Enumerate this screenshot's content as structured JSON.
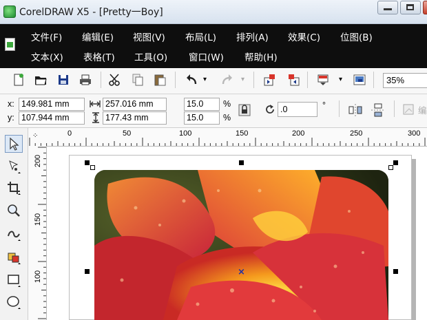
{
  "window": {
    "title": "CorelDRAW X5 - [Pretty一Boy]"
  },
  "menu": {
    "row1": [
      "文件(F)",
      "编辑(E)",
      "视图(V)",
      "布局(L)",
      "排列(A)",
      "效果(C)",
      "位图(B)"
    ],
    "row2": [
      "文本(X)",
      "表格(T)",
      "工具(O)",
      "窗口(W)",
      "帮助(H)"
    ]
  },
  "toolbar": {
    "zoom": "35%"
  },
  "propbar": {
    "x_label": "x:",
    "x_value": "149.981 mm",
    "y_label": "y:",
    "y_value": "107.944 mm",
    "width_value": "257.016 mm",
    "height_value": "177.43 mm",
    "scale_x": "15.0",
    "scale_y": "15.0",
    "percent": "%",
    "rotation": ".0",
    "degree": "°",
    "truncated_label": "编"
  },
  "ruler": {
    "h_ticks": [
      "0",
      "50",
      "100",
      "150",
      "200",
      "250",
      "300"
    ],
    "v_ticks": [
      "200",
      "150",
      "100"
    ]
  },
  "canvas": {
    "center_mark": "×"
  }
}
